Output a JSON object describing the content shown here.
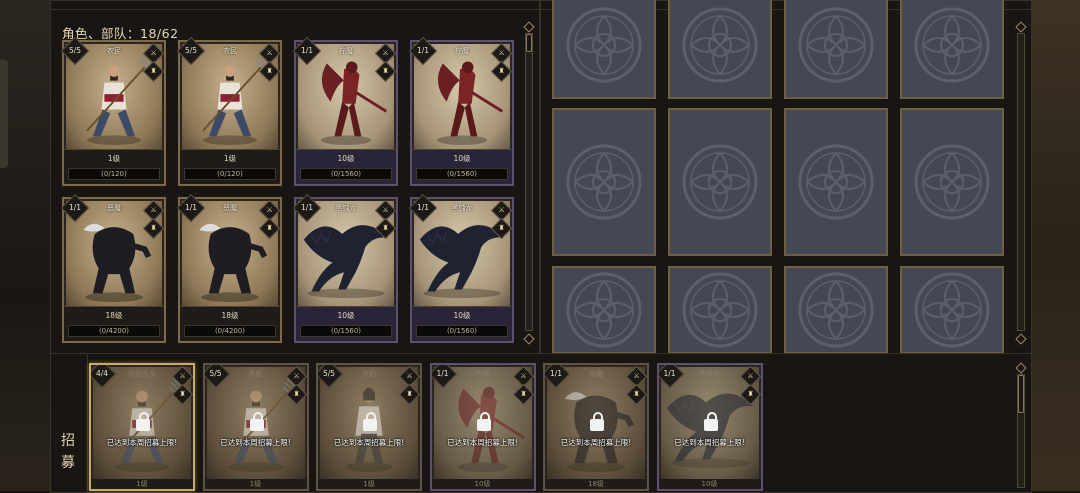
{
  "roster": {
    "title": "角色、部队：18/62",
    "cards": [
      {
        "name": "农民",
        "count": "5/5",
        "level": "1级",
        "xp": "(0/120)",
        "frame": "gold",
        "art": "peasant"
      },
      {
        "name": "农民",
        "count": "5/5",
        "level": "1级",
        "xp": "(0/120)",
        "frame": "gold",
        "art": "peasant"
      },
      {
        "name": "狞魔",
        "count": "1/1",
        "level": "10级",
        "xp": "(0/1560)",
        "frame": "purple",
        "art": "demon"
      },
      {
        "name": "狞魔",
        "count": "1/1",
        "level": "10级",
        "xp": "(0/1560)",
        "frame": "purple",
        "art": "demon"
      },
      {
        "name": "恶魔",
        "count": "1/1",
        "level": "18级",
        "xp": "(0/4200)",
        "frame": "gold",
        "art": "beast"
      },
      {
        "name": "恶魔",
        "count": "1/1",
        "level": "18级",
        "xp": "(0/4200)",
        "frame": "gold",
        "art": "beast"
      },
      {
        "name": "黑蚀龙",
        "count": "1/1",
        "level": "10级",
        "xp": "(0/1560)",
        "frame": "purple",
        "art": "dragon"
      },
      {
        "name": "黑蚀龙",
        "count": "1/1",
        "level": "10级",
        "xp": "(0/1560)",
        "frame": "purple",
        "art": "dragon"
      }
    ]
  },
  "recruit": {
    "label_top": "招",
    "label_bottom": "募",
    "cards": [
      {
        "name": "农民队长",
        "count": "4/4",
        "level": "1级",
        "message": "已达到本周招募上限!",
        "frame": "gold",
        "art": "peasant"
      },
      {
        "name": "农民",
        "count": "5/5",
        "level": "1级",
        "message": "已达到本周招募上限!",
        "frame": "gold",
        "art": "peasant"
      },
      {
        "name": "农妇",
        "count": "5/5",
        "level": "1级",
        "message": "已达到本周招募上限!",
        "frame": "gold",
        "art": "woman"
      },
      {
        "name": "狞魔",
        "count": "1/1",
        "level": "10级",
        "message": "已达到本周招募上限!",
        "frame": "purple",
        "art": "demon"
      },
      {
        "name": "恶魔",
        "count": "1/1",
        "level": "18级",
        "message": "已达到本周招募上限!",
        "frame": "gold",
        "art": "beast"
      },
      {
        "name": "黑蚀龙",
        "count": "1/1",
        "level": "10级",
        "message": "已达到本周招募上限!",
        "frame": "purple",
        "art": "dragon"
      }
    ]
  },
  "icons": {
    "class_icon": "shield-crest-icon",
    "weapon_icon": "sword-icon",
    "empty_slot": "sigil-emblem-icon",
    "lock": "padlock-icon"
  },
  "colors": {
    "gold_frame": "#7d6a4a",
    "purple_frame": "#5e5170",
    "slot_bg": "#434853",
    "selected": "#c9ad5d"
  }
}
